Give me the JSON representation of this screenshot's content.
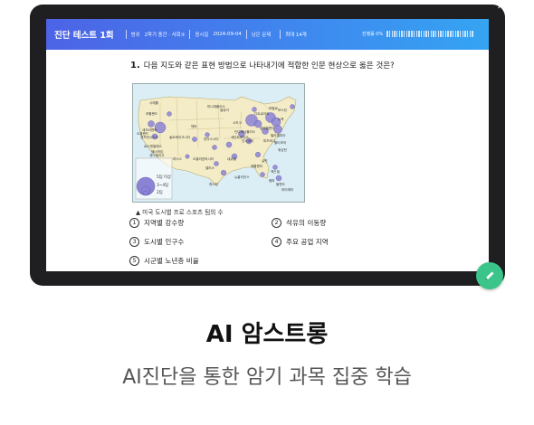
{
  "header": {
    "title": "진단 테스트 1회",
    "range_label": "범위",
    "range_value": "2학기 중간 · 사회①",
    "date_label": "응시일",
    "date_value": "2024-09-04",
    "remaining_label": "남은 문제",
    "max_label": "최대 14개",
    "progress_label": "진행률 0%",
    "progress_fraction": 0
  },
  "question": {
    "number": "1.",
    "text": "다음 지도와 같은 표현 방법으로 나타내기에 적합한 인문 현상으로 옳은 것은?",
    "map_caption": "▲ 미국 도시별 프로 스포츠 팀의 수",
    "map_legend": [
      "5팀 이상",
      "3~4팀",
      "2팀"
    ],
    "city_labels": [
      "시애틀",
      "미니애폴리스",
      "보스턴",
      "뉴욕",
      "필라델피아",
      "디트로이트",
      "시카고",
      "밀워키",
      "클리블랜드",
      "피츠버그",
      "볼티모어",
      "워싱턴",
      "포틀랜드",
      "덴버",
      "캔자스시티",
      "세인트루이스",
      "신시내티",
      "인디애나폴리스",
      "버펄로",
      "솔트레이크시티",
      "내슈빌",
      "샬럿",
      "애틀랜타",
      "탬파",
      "올랜도",
      "마이애미",
      "뉴올리언스",
      "휴스턴",
      "댈러스",
      "피닉스",
      "새크라멘토",
      "샌프란시스코",
      "로스앤젤레스",
      "샌디에이고",
      "오클라호마시티",
      "잭슨빌",
      "오클랜드",
      "애너하임"
    ],
    "options": [
      {
        "num": "1",
        "text": "지역별 강수량"
      },
      {
        "num": "2",
        "text": "석유의 이동량"
      },
      {
        "num": "3",
        "text": "도시별 인구수"
      },
      {
        "num": "4",
        "text": "주요 공업 지역"
      },
      {
        "num": "5",
        "text": "시군별 노년층 비율"
      }
    ]
  },
  "app": {
    "title": "AI 암스트롱",
    "subtitle": "AI진단을 통한 암기 과목 집중 학습"
  },
  "colors": {
    "header_start": "#4d63e6",
    "header_end": "#35a4f2",
    "fab": "#3cc58a",
    "bubble": "#8b84d6",
    "land": "#f3ecc6",
    "water": "#dbeef5"
  },
  "icons": {
    "fab": "pencil-icon",
    "close": "close-icon"
  }
}
